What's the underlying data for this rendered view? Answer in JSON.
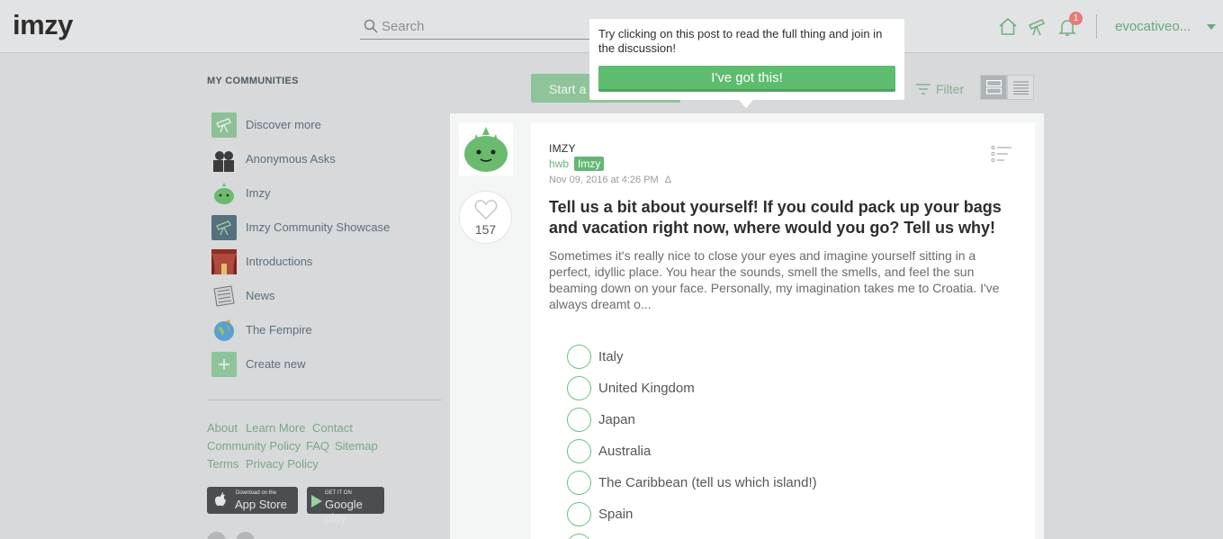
{
  "header": {
    "logo": "imzy",
    "search_placeholder": "Search",
    "notification_count": "1",
    "username": "evocativeo..."
  },
  "sidebar": {
    "heading": "MY COMMUNITIES",
    "items": [
      {
        "label": "Discover more",
        "icon": "telescope-icon",
        "color": "#8fbf97"
      },
      {
        "label": "Anonymous Asks",
        "icon": "anonymous-figures-icon",
        "color": "#4a4a4a"
      },
      {
        "label": "Imzy",
        "icon": "imzy-mascot-icon",
        "color": "#6abb6e"
      },
      {
        "label": "Imzy Community Showcase",
        "icon": "telescope-icon",
        "color": "#56707d"
      },
      {
        "label": "Introductions",
        "icon": "stage-curtain-icon",
        "color": "#b04a3e"
      },
      {
        "label": "News",
        "icon": "newspaper-icon",
        "color": "#8a8a8a"
      },
      {
        "label": "The Fempire",
        "icon": "globe-bird-icon",
        "color": "#5aa0d0"
      },
      {
        "label": "Create new",
        "icon": "plus-icon",
        "color": "#8fc49b"
      }
    ],
    "footer_links": {
      "about": "About",
      "learn_more": "Learn More",
      "contact": "Contact",
      "community_policy": "Community Policy",
      "faq": "FAQ",
      "sitemap": "Sitemap",
      "terms": "Terms",
      "privacy": "Privacy Policy"
    },
    "app_store": {
      "small": "Download on the",
      "big": "App Store"
    },
    "google_play": {
      "small": "GET IT ON",
      "big": "Google play"
    }
  },
  "toolbar": {
    "start_label": "Start a",
    "filter_label": "Filter"
  },
  "post": {
    "like_count": "157",
    "community": "IMZY",
    "author": "hwb",
    "tag": "Imzy",
    "timestamp": "Nov 09, 2016 at 4:26 PM",
    "title": "Tell us a bit about yourself! If you could pack up your bags and vacation right now, where would you go? Tell us why!",
    "excerpt": "Sometimes it's really nice to close your eyes and imagine yourself sitting in a perfect, idyllic place. You hear the sounds, smell the smells, and feel the sun beaming down on your face. Personally, my imagination takes me to Croatia. I've always dreamt o...",
    "options": [
      "Italy",
      "United Kingdom",
      "Japan",
      "Australia",
      "The Caribbean (tell us which island!)",
      "Spain"
    ]
  },
  "tooltip": {
    "text": "Try clicking on this post to read the full thing and join in the discussion!",
    "button": "I've got this!"
  },
  "colors": {
    "accent": "#5ebc6f",
    "link": "#7aa888",
    "badge": "#e87a7a"
  }
}
